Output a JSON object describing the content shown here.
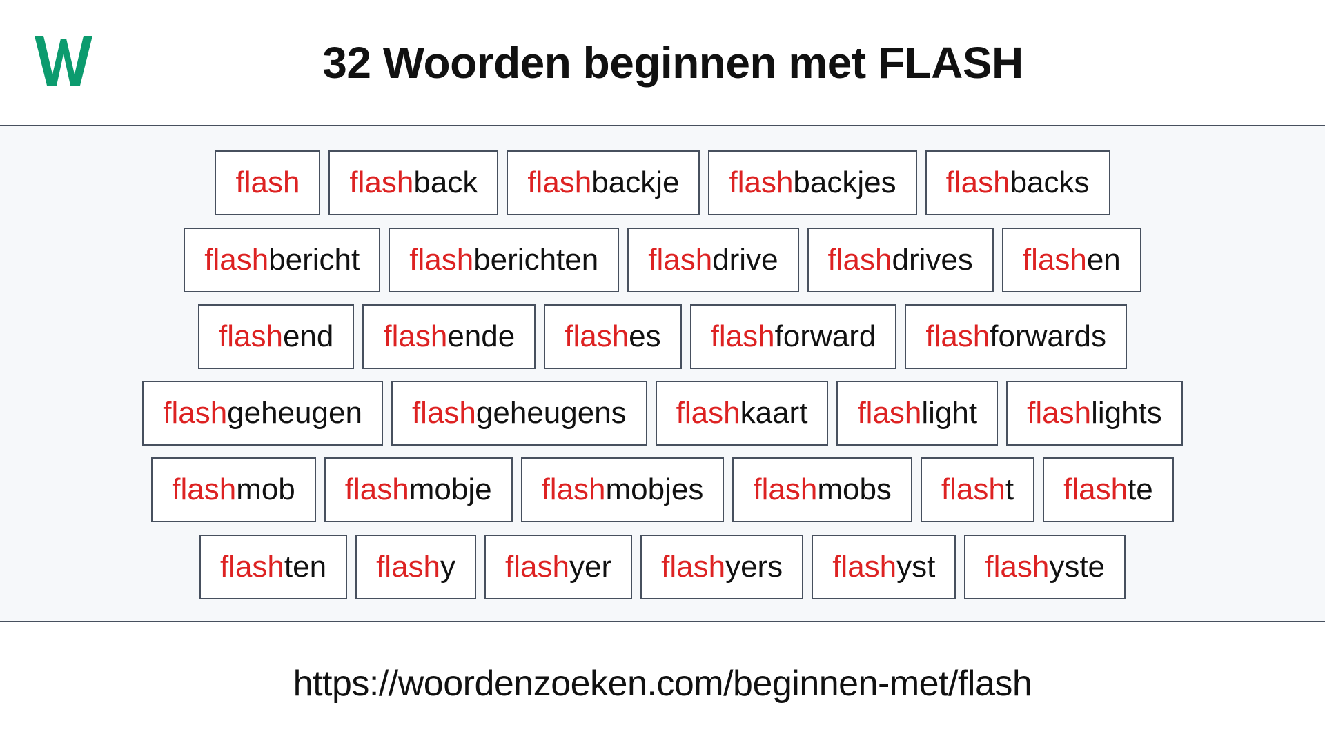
{
  "header": {
    "logo_letter": "W",
    "logo_color": "#0c9b6e",
    "title": "32 Woorden beginnen met FLASH"
  },
  "theme": {
    "prefix_color": "#dd2222",
    "suffix_color": "#111111",
    "box_border_color": "#47505e",
    "panel_background": "#f6f8fa",
    "box_background": "#ffffff"
  },
  "words": {
    "prefix": "flash",
    "count": 32,
    "rows": [
      [
        {
          "prefix": "flash",
          "suffix": ""
        },
        {
          "prefix": "flash",
          "suffix": "back"
        },
        {
          "prefix": "flash",
          "suffix": "backje"
        },
        {
          "prefix": "flash",
          "suffix": "backjes"
        },
        {
          "prefix": "flash",
          "suffix": "backs"
        }
      ],
      [
        {
          "prefix": "flash",
          "suffix": "bericht"
        },
        {
          "prefix": "flash",
          "suffix": "berichten"
        },
        {
          "prefix": "flash",
          "suffix": "drive"
        },
        {
          "prefix": "flash",
          "suffix": "drives"
        },
        {
          "prefix": "flash",
          "suffix": "en"
        }
      ],
      [
        {
          "prefix": "flash",
          "suffix": "end"
        },
        {
          "prefix": "flash",
          "suffix": "ende"
        },
        {
          "prefix": "flash",
          "suffix": "es"
        },
        {
          "prefix": "flash",
          "suffix": "forward"
        },
        {
          "prefix": "flash",
          "suffix": "forwards"
        }
      ],
      [
        {
          "prefix": "flash",
          "suffix": "geheugen"
        },
        {
          "prefix": "flash",
          "suffix": "geheugens"
        },
        {
          "prefix": "flash",
          "suffix": "kaart"
        },
        {
          "prefix": "flash",
          "suffix": "light"
        },
        {
          "prefix": "flash",
          "suffix": "lights"
        }
      ],
      [
        {
          "prefix": "flash",
          "suffix": "mob"
        },
        {
          "prefix": "flash",
          "suffix": "mobje"
        },
        {
          "prefix": "flash",
          "suffix": "mobjes"
        },
        {
          "prefix": "flash",
          "suffix": "mobs"
        },
        {
          "prefix": "flash",
          "suffix": "t"
        },
        {
          "prefix": "flash",
          "suffix": "te"
        }
      ],
      [
        {
          "prefix": "flash",
          "suffix": "ten"
        },
        {
          "prefix": "flash",
          "suffix": "y"
        },
        {
          "prefix": "flash",
          "suffix": "yer"
        },
        {
          "prefix": "flash",
          "suffix": "yers"
        },
        {
          "prefix": "flash",
          "suffix": "yst"
        },
        {
          "prefix": "flash",
          "suffix": "yste"
        }
      ]
    ]
  },
  "footer": {
    "url": "https://woordenzoeken.com/beginnen-met/flash"
  }
}
